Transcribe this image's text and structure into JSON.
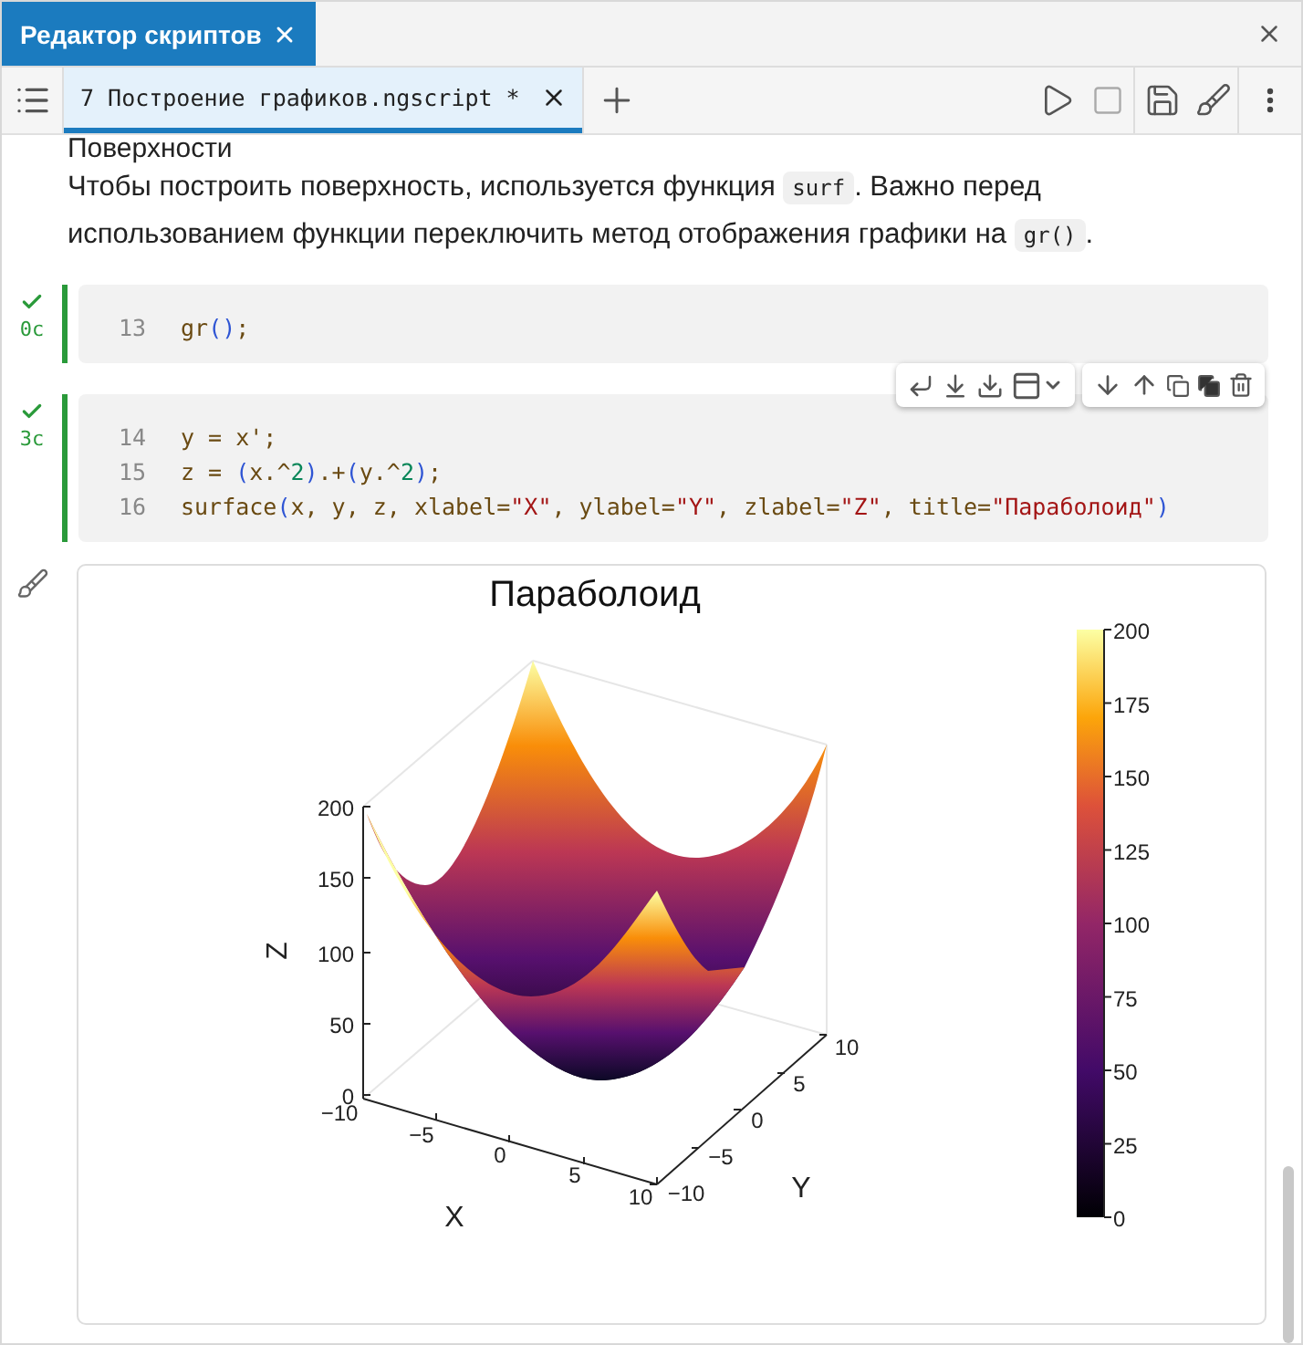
{
  "window": {
    "title": "Редактор скриптов",
    "selected": true
  },
  "file_tab": {
    "label": "7 Построение графиков.ngscript *",
    "selected": true
  },
  "section_heading": "Поверхности",
  "paragraph": [
    {
      "kind": "text",
      "text": "Чтобы построить поверхность, используется функция "
    },
    {
      "kind": "code",
      "text": "surf"
    },
    {
      "kind": "text",
      "text": ". Важно перед использованием функции переключить метод отображения графики на "
    },
    {
      "kind": "code",
      "text": "gr()"
    },
    {
      "kind": "text",
      "text": "."
    }
  ],
  "cells": [
    {
      "done": true,
      "time": "0с",
      "lines": [
        {
          "number": "13",
          "tokens": [
            {
              "kind": "plain",
              "text": "gr"
            },
            {
              "kind": "paren",
              "text": "()"
            },
            {
              "kind": "plain",
              "text": ";"
            }
          ]
        }
      ]
    },
    {
      "done": true,
      "time": "3с",
      "lines": [
        {
          "number": "14",
          "tokens": [
            {
              "kind": "plain",
              "text": "y = x';"
            }
          ]
        },
        {
          "number": "15",
          "tokens": [
            {
              "kind": "plain",
              "text": "z = "
            },
            {
              "kind": "paren",
              "text": "("
            },
            {
              "kind": "plain",
              "text": "x.^"
            },
            {
              "kind": "number",
              "text": "2"
            },
            {
              "kind": "paren",
              "text": ")"
            },
            {
              "kind": "plain",
              "text": ".+"
            },
            {
              "kind": "paren",
              "text": "("
            },
            {
              "kind": "plain",
              "text": "y.^"
            },
            {
              "kind": "number",
              "text": "2"
            },
            {
              "kind": "paren",
              "text": ")"
            },
            {
              "kind": "plain",
              "text": ";"
            }
          ]
        },
        {
          "number": "16",
          "tokens": [
            {
              "kind": "plain",
              "text": "surface"
            },
            {
              "kind": "paren",
              "text": "("
            },
            {
              "kind": "plain",
              "text": "x, y, z, xlabel="
            },
            {
              "kind": "string",
              "text": "\"X\""
            },
            {
              "kind": "plain",
              "text": ", ylabel="
            },
            {
              "kind": "string",
              "text": "\"Y\""
            },
            {
              "kind": "plain",
              "text": ", zlabel="
            },
            {
              "kind": "string",
              "text": "\"Z\""
            },
            {
              "kind": "plain",
              "text": ", title="
            },
            {
              "kind": "string",
              "text": "\"Параболоид\""
            },
            {
              "kind": "paren",
              "text": ")"
            }
          ]
        }
      ]
    }
  ],
  "plot": {
    "title": "Параболоид",
    "xlabel": "X",
    "ylabel": "Y",
    "zlabel": "Z",
    "xticks": [
      "−10",
      "−5",
      "0",
      "5",
      "10"
    ],
    "yticks": [
      "−10",
      "−5",
      "0",
      "5",
      "10"
    ],
    "zticks": [
      "200",
      "150",
      "100",
      "50",
      "0"
    ],
    "colorbar_ticks": [
      "200",
      "175",
      "150",
      "125",
      "100",
      "75",
      "50",
      "25",
      "0"
    ]
  }
}
